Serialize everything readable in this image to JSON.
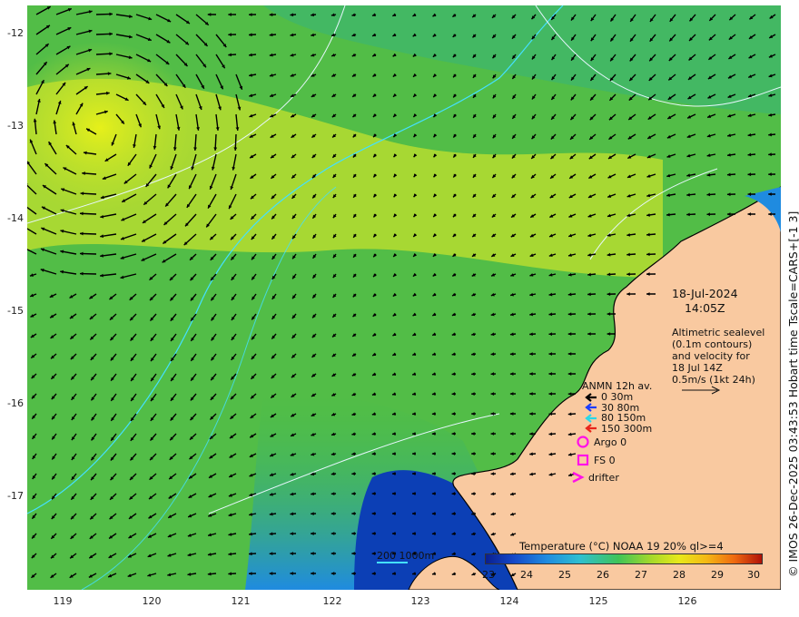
{
  "map": {
    "x_ticks": [
      "119",
      "120",
      "121",
      "122",
      "123",
      "124",
      "125",
      "126"
    ],
    "y_ticks": [
      "-12",
      "-13",
      "-14",
      "-15",
      "-16",
      "-17"
    ],
    "colors": {
      "land": "#f9c9a0",
      "ocean_warm": "#5cc14a",
      "ocean_yellow": "#e0ee22",
      "ocean_cool": "#1f8be0",
      "ocean_cold": "#0a2a9a",
      "contour": "#e8f7ff",
      "isobath": "#44e0ff",
      "arrow": "#000000"
    }
  },
  "date_block": {
    "date": "18-Jul-2024",
    "time": "14:05Z"
  },
  "altimetry_block": {
    "line1": "Altimetric sealevel",
    "line2": "(0.1m contours)",
    "line3": "and velocity for",
    "line4": "18 Jul 14Z",
    "line5": "0.5m/s (1kt 24h)"
  },
  "anmn": {
    "title": "ANMN 12h av.",
    "rows": [
      {
        "label": "0 30m",
        "color": "#000000"
      },
      {
        "label": "30 80m",
        "color": "#1a3cff"
      },
      {
        "label": "80 150m",
        "color": "#27d7e8"
      },
      {
        "label": "150 300m",
        "color": "#e8241b"
      }
    ]
  },
  "symbols": {
    "argo": "Argo 0",
    "fs": "FS 0",
    "drifter": "drifter",
    "magenta": "#ff10e8"
  },
  "depth_legend": {
    "label": "200  1000m"
  },
  "colorbar": {
    "title": "Temperature (°C) NOAA 19 20% ql>=4",
    "ticks": [
      "23",
      "24",
      "25",
      "26",
      "27",
      "28",
      "29",
      "30"
    ]
  },
  "credit": "© IMOS 26-Dec-2025 03:43:53 Hobart time Tscale=CARS+[-1 3]"
}
